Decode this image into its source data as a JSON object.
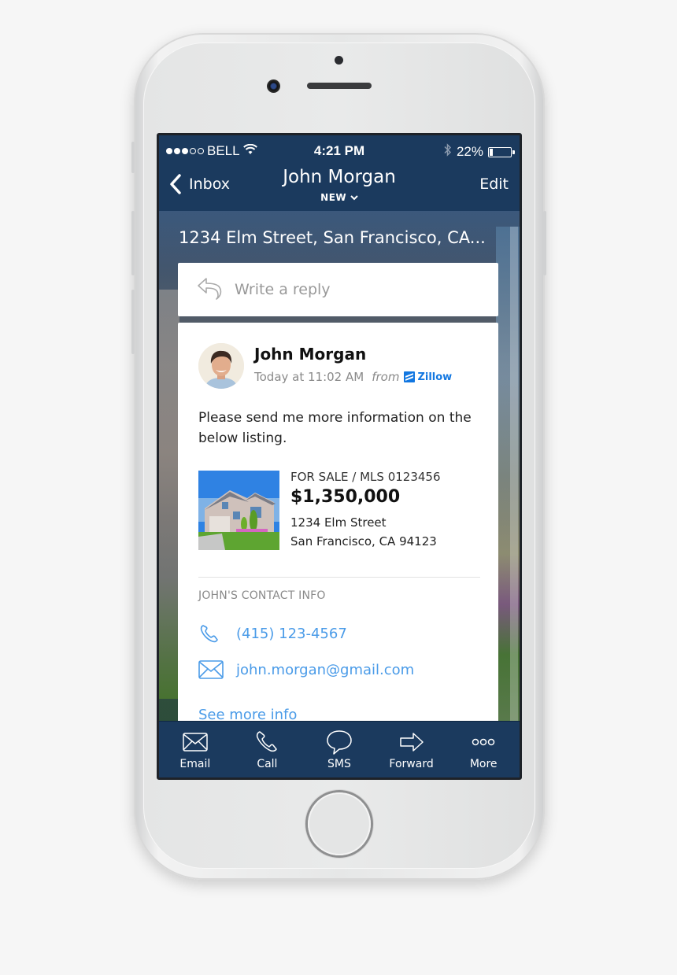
{
  "status_bar": {
    "carrier": "BELL",
    "signal_bars_filled": 3,
    "signal_bars_total": 5,
    "time": "4:21 PM",
    "battery_percent_label": "22%",
    "battery_level": 0.22,
    "icons": [
      "wifi-icon",
      "bluetooth-icon",
      "battery-icon"
    ]
  },
  "nav": {
    "back_label": "Inbox",
    "title": "John Morgan",
    "subtitle": "NEW",
    "edit_label": "Edit"
  },
  "thread": {
    "address_title": "1234 Elm Street, San Francisco, CA...",
    "reply_placeholder": "Write a reply"
  },
  "message": {
    "sender": "John Morgan",
    "timestamp": "Today at 11:02 AM",
    "from_label": "from",
    "source": "Zillow",
    "body": "Please send me more information on the below listing."
  },
  "listing": {
    "status_line": "FOR SALE  /  MLS 0123456",
    "price": "$1,350,000",
    "address_line1": "1234 Elm Street",
    "address_line2": "San Francisco, CA 94123"
  },
  "contact": {
    "heading": "JOHN'S CONTACT INFO",
    "phone": "(415) 123-4567",
    "email": "john.morgan@gmail.com",
    "see_more": "See more info"
  },
  "tab_bar": {
    "items": [
      {
        "label": "Email",
        "icon": "envelope-icon"
      },
      {
        "label": "Call",
        "icon": "phone-icon"
      },
      {
        "label": "SMS",
        "icon": "speech-bubble-icon"
      },
      {
        "label": "Forward",
        "icon": "forward-arrow-icon"
      },
      {
        "label": "More",
        "icon": "more-dots-icon"
      }
    ]
  },
  "colors": {
    "nav_bg": "#1b3a5e",
    "link_blue": "#4a9be8",
    "zillow_blue": "#1277e1"
  }
}
